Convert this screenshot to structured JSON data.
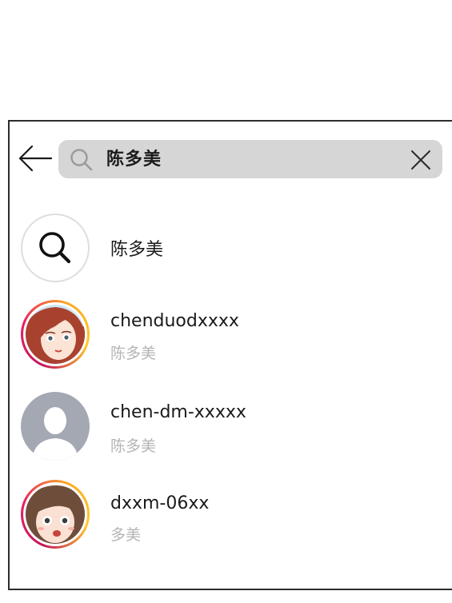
{
  "search": {
    "query": "陈多美"
  },
  "results": [
    {
      "kind": "query",
      "title": "陈多美",
      "subtitle": ""
    },
    {
      "kind": "user",
      "title": "chenduodxxxx",
      "subtitle": "陈多美"
    },
    {
      "kind": "user",
      "title": "chen-dm-xxxxx",
      "subtitle": "陈多美"
    },
    {
      "kind": "user",
      "title": "dxxm-06xx",
      "subtitle": "多美"
    }
  ],
  "icons": {
    "back": "back-arrow-icon",
    "search": "search-icon",
    "clear": "close-icon"
  },
  "colors": {
    "search_bar_bg": "#d6d6d6",
    "subtitle_text": "#b4b4b4",
    "ring_gradient_start": "#c2185b",
    "ring_gradient_end": "#f9a825",
    "placeholder_avatar": "#a3a8b2"
  }
}
